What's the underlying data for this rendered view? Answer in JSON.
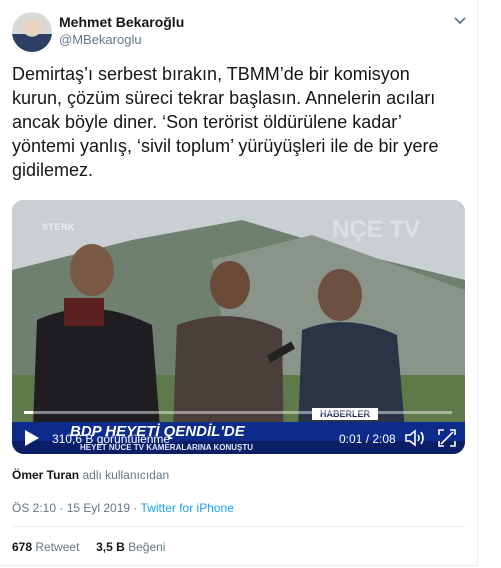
{
  "author": {
    "name": "Mehmet Bekaroğlu",
    "handle": "@MBekaroglu"
  },
  "tweet": {
    "text": "Demirtaş’ı serbest bırakın, TBMM’de bir komisyon kurun, çözüm süreci tekrar başlasın. Annelerin acıları ancak böyle diner. ‘Son terörist öldürülene kadar’ yöntemi yanlış, ‘sivil toplum’ yürüyüşleri ile de bir yere gidilemez."
  },
  "video": {
    "channel_logo": "STERK",
    "watermark": "NÇE TV",
    "news_tag": "HABERLER",
    "headline": "BDP HEYETİ QENDİL'DE",
    "subline": "HEYET NÜCE TV KAMERALARINA KONUŞTU",
    "views": "310,6 B görüntülenme",
    "time": "0:01 / 2:08",
    "progress": 0.01
  },
  "credit": {
    "user": "Ömer Turan",
    "suffix": "adlı kullanıcıdan"
  },
  "meta": {
    "timestamp": "ÖS 2:10 · 15 Eyl 2019 · ",
    "source": "Twitter for iPhone"
  },
  "stats": {
    "retweets": "678",
    "retweets_label": "Retweet",
    "likes": "3,5 B",
    "likes_label": "Beğeni"
  },
  "icons": [
    "chevron-down-icon",
    "play-icon",
    "volume-icon",
    "fullscreen-icon"
  ]
}
